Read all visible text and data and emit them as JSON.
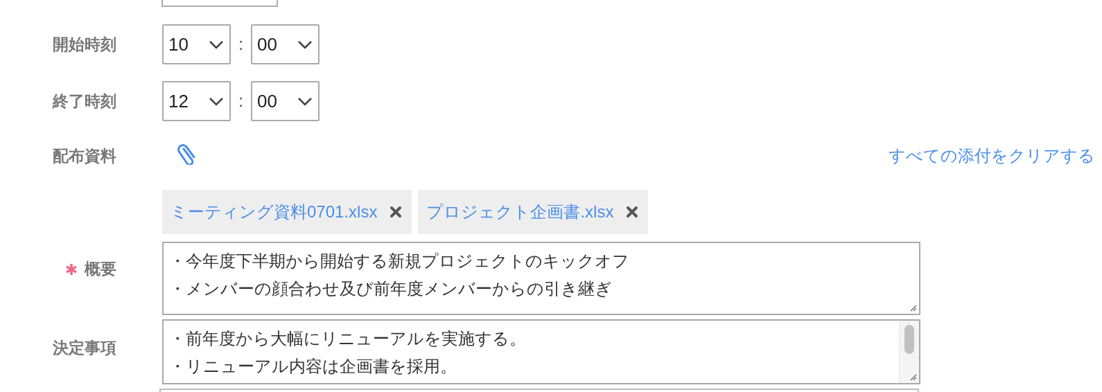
{
  "form": {
    "start_time": {
      "label": "開始時刻",
      "hour": "10",
      "separator": ":",
      "minute": "00"
    },
    "end_time": {
      "label": "終了時刻",
      "hour": "12",
      "separator": ":",
      "minute": "00"
    },
    "attachments": {
      "label": "配布資料",
      "clear_link": "すべての添付をクリアする",
      "files": [
        {
          "name": "ミーティング資料0701.xlsx"
        },
        {
          "name": "プロジェクト企画書.xlsx"
        }
      ]
    },
    "fields": [
      {
        "label": "概要",
        "required": true,
        "scrollable": false,
        "lines": [
          "・今年度下半期から開始する新規プロジェクトのキックオフ",
          "・メンバーの顔合わせ及び前年度メンバーからの引き継ぎ"
        ]
      },
      {
        "label": "決定事項",
        "required": false,
        "scrollable": true,
        "lines": [
          "・前年度から大幅にリニューアルを実施する。",
          "・リニューアル内容は企画書を採用。"
        ]
      }
    ]
  }
}
